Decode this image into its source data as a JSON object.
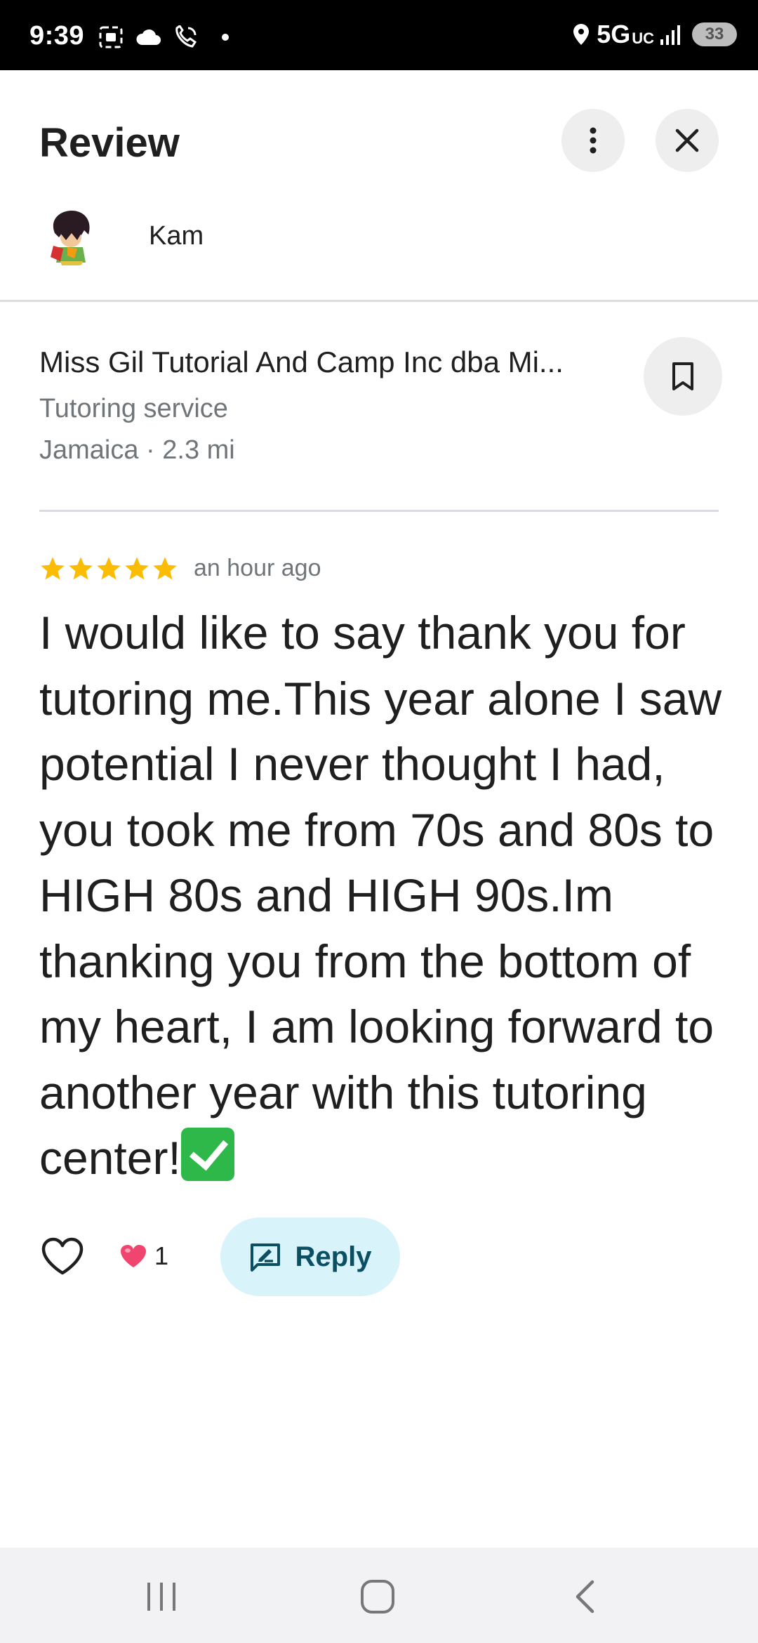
{
  "status_bar": {
    "time": "9:39",
    "network": "5G",
    "network_sub": "UC",
    "battery": "33"
  },
  "header": {
    "title": "Review",
    "more_icon": "more-vert-icon",
    "close_icon": "close-icon"
  },
  "author": {
    "name": "Kam"
  },
  "place": {
    "name": "Miss Gil Tutorial And Camp Inc dba Mi...",
    "category": "Tutoring service",
    "location": "Jamaica · 2.3 mi",
    "save_icon": "bookmark-icon"
  },
  "review": {
    "stars": 5,
    "star_color": "#fbbc04",
    "time": "an hour ago",
    "text": "I would like to say thank you for tutoring me.This year alone I saw potential I never thought I had, you took me from 70s and 80s to HIGH 80s and HIGH 90s.Im thanking you from the bottom of my heart, I am looking forward to another year with this tutoring center!"
  },
  "actions": {
    "like_icon": "heart-outline-icon",
    "reaction_icon": "pink-heart-icon",
    "reaction_count": "1",
    "reply_label": "Reply",
    "reply_color": "#d8f4fa"
  },
  "nav_bar": {
    "recent_icon": "recent-apps-icon",
    "home_icon": "home-icon",
    "back_icon": "back-icon"
  }
}
